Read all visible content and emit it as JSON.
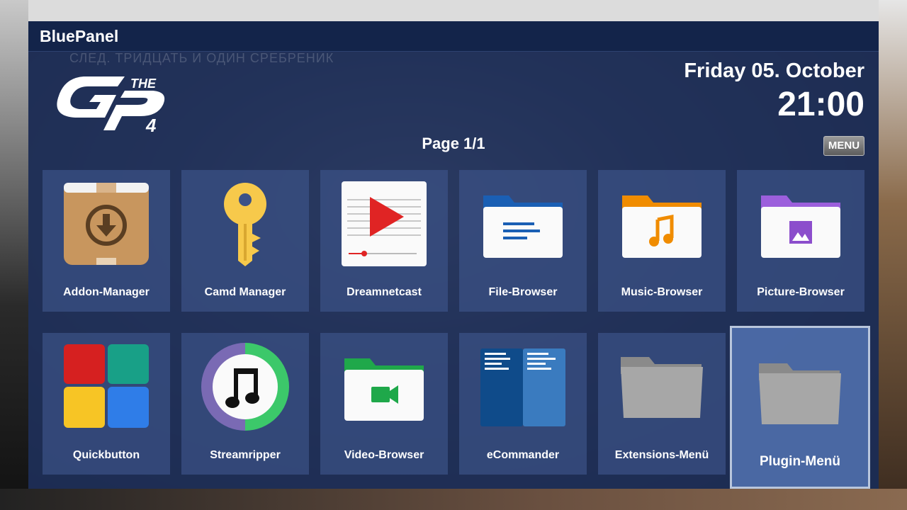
{
  "window": {
    "title": "BluePanel"
  },
  "overlay": {
    "ghost_text": "СЛЕД. ТРИДЦАТЬ И ОДИН СРЕБРЕНИК"
  },
  "header": {
    "date": "Friday 05. October",
    "time": "21:00",
    "page": "Page 1/1",
    "menu_label": "MENU"
  },
  "logo": {
    "text": "THE GP4"
  },
  "grid": {
    "row1": [
      {
        "label": "Addon-Manager",
        "icon": "package-download-icon"
      },
      {
        "label": "Camd Manager",
        "icon": "key-icon"
      },
      {
        "label": "Dreamnetcast",
        "icon": "video-player-icon"
      },
      {
        "label": "File-Browser",
        "icon": "folder-document-icon"
      },
      {
        "label": "Music-Browser",
        "icon": "folder-music-icon"
      },
      {
        "label": "Picture-Browser",
        "icon": "folder-picture-icon"
      }
    ],
    "row2": [
      {
        "label": "Quickbutton",
        "icon": "four-squares-icon"
      },
      {
        "label": "Streamripper",
        "icon": "music-note-icon"
      },
      {
        "label": "Video-Browser",
        "icon": "folder-video-icon"
      },
      {
        "label": "eCommander",
        "icon": "dual-pane-icon"
      },
      {
        "label": "Extensions-Menü",
        "icon": "folder-gray-icon"
      },
      {
        "label": "Plugin-Menü",
        "icon": "folder-gray-icon",
        "selected": true
      }
    ]
  },
  "colors": {
    "panel": "#1c2e5c",
    "titlebar": "#13244a",
    "tile": "#3c5287",
    "selected_tile": "#4e6eaa"
  }
}
